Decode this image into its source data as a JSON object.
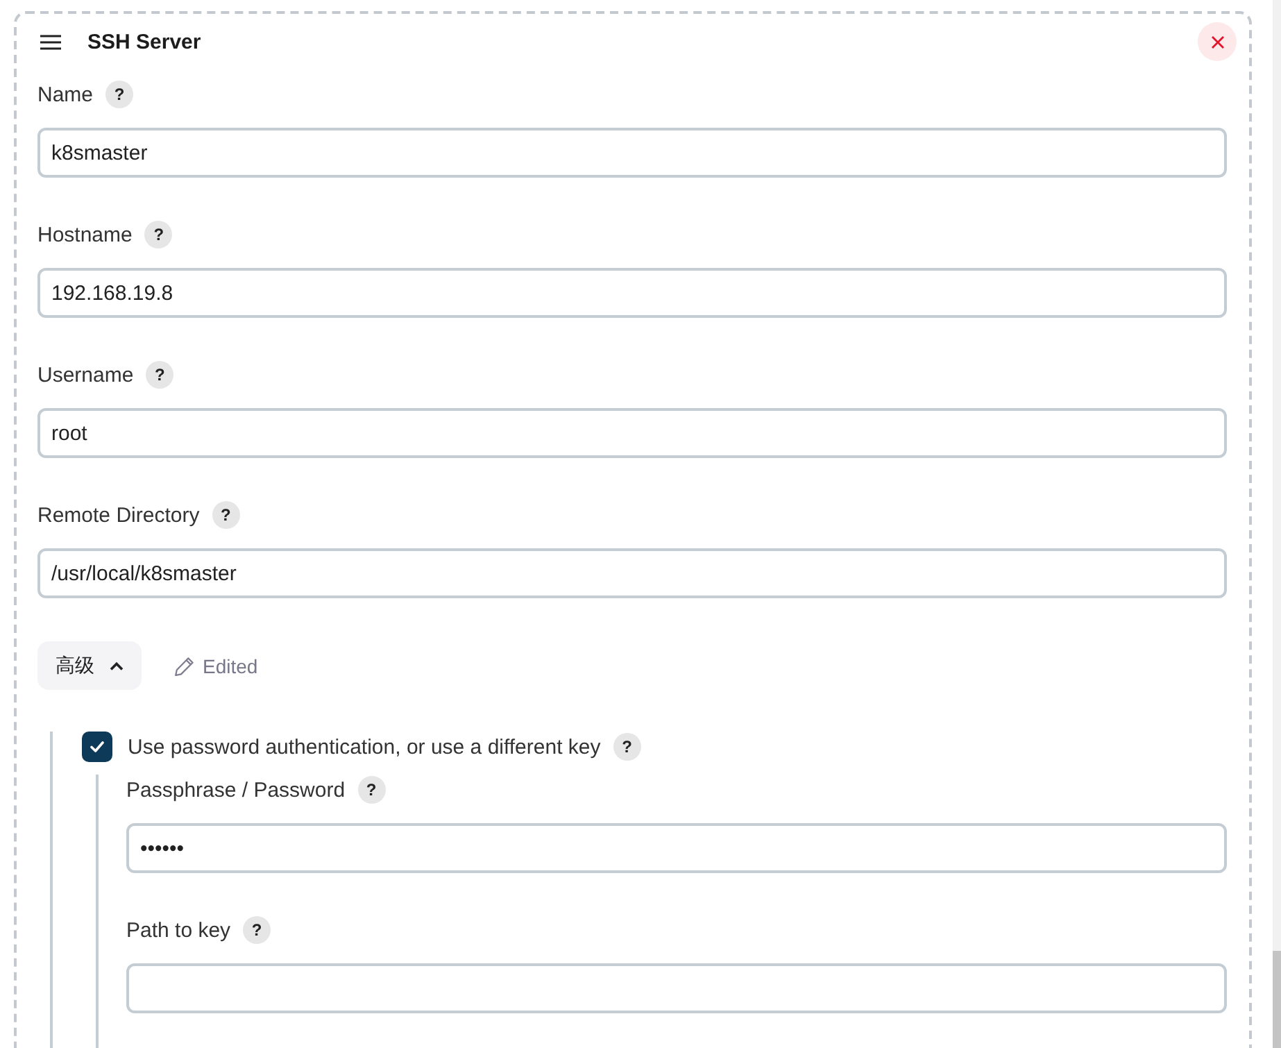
{
  "panel": {
    "title": "SSH Server",
    "fields": [
      {
        "label": "Name",
        "help": "?",
        "value": "k8smaster"
      },
      {
        "label": "Hostname",
        "help": "?",
        "value": "192.168.19.8"
      },
      {
        "label": "Username",
        "help": "?",
        "value": "root"
      },
      {
        "label": "Remote Directory",
        "help": "?",
        "value": "/usr/local/k8smaster"
      }
    ],
    "advanced": {
      "label": "高级",
      "expanded": true,
      "status": "Edited"
    },
    "password_auth": {
      "label": "Use password authentication, or use a different key",
      "help": "?",
      "checked": true,
      "fields": [
        {
          "label": "Passphrase / Password",
          "help": "?",
          "value": "••••••"
        },
        {
          "label": "Path to key",
          "help": "?"
        }
      ]
    }
  }
}
